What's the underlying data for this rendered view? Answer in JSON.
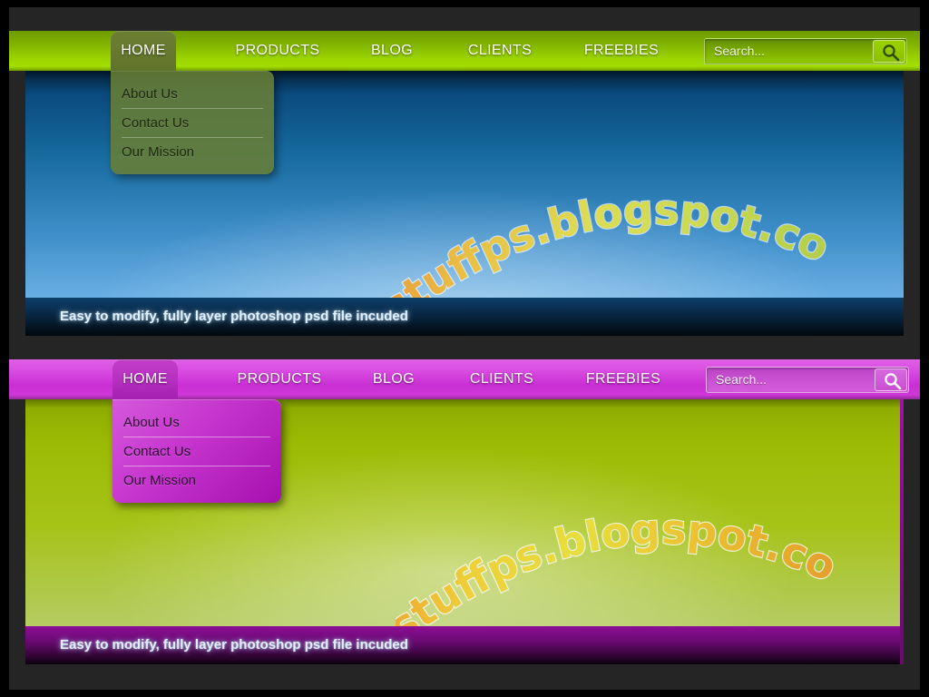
{
  "page": {
    "background_color": "#252525",
    "frame_color": "#000000"
  },
  "nav": {
    "items": [
      {
        "label": "HOME",
        "active": true
      },
      {
        "label": "PRODUCTS",
        "active": false
      },
      {
        "label": "BLOG",
        "active": false
      },
      {
        "label": "CLIENTS",
        "active": false
      },
      {
        "label": "FREEBIES",
        "active": false
      }
    ]
  },
  "dropdown": {
    "items": [
      {
        "label": "About Us"
      },
      {
        "label": "Contact Us"
      },
      {
        "label": "Our Mission"
      }
    ]
  },
  "search": {
    "placeholder": "Search...",
    "value": "",
    "icon": "search-icon"
  },
  "watermark": {
    "text": "stuffps.blogspot.com"
  },
  "footer": {
    "text": "Easy to modify, fully layer photoshop psd file incuded"
  },
  "variants": [
    {
      "id": "green-blue",
      "nav_color": "#9bd400",
      "nav_accent": "#6d9c00",
      "body_color": "#166a9e",
      "footer_color": "#0a2c4c",
      "dropdown_color": "#687e36"
    },
    {
      "id": "magenta-lime",
      "nav_color": "#d23bdb",
      "nav_accent": "#a610af",
      "body_color": "#a6c318",
      "footer_color": "#6c0a74",
      "dropdown_color": "#c534cd"
    }
  ]
}
